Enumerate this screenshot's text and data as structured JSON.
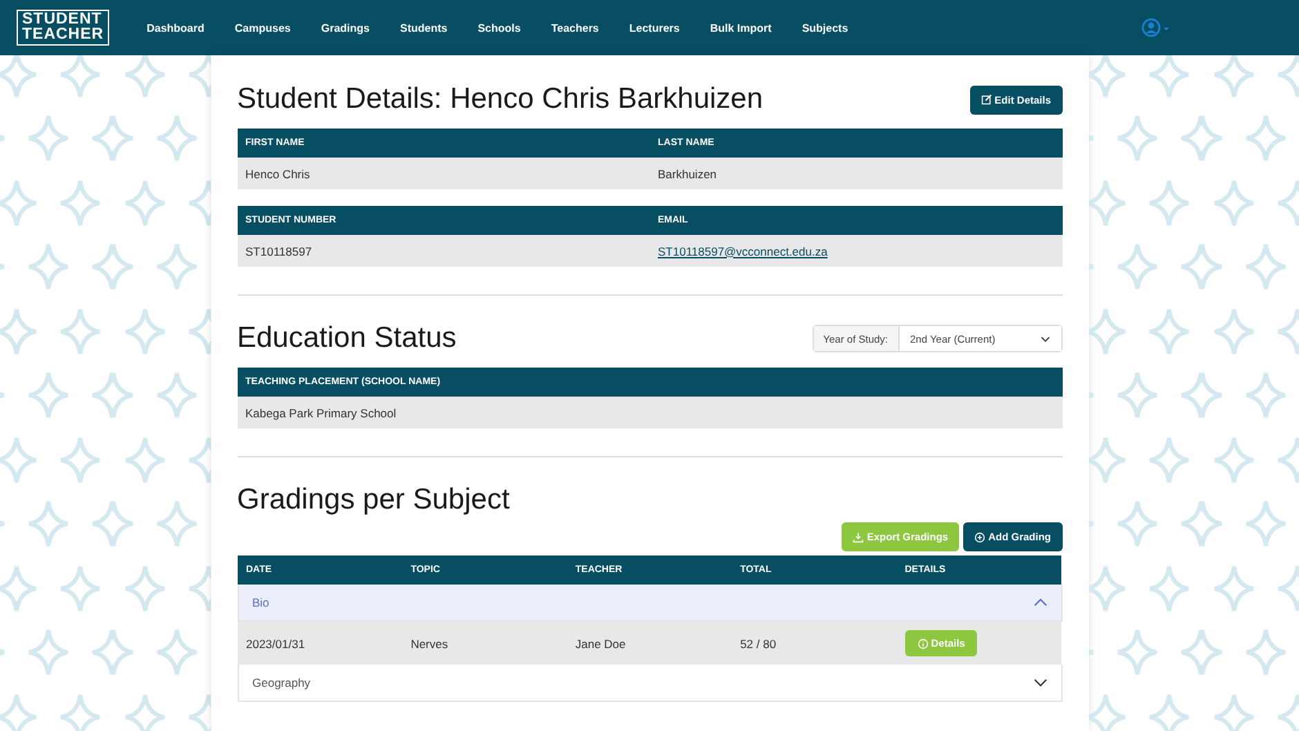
{
  "nav": {
    "logo": [
      "STUDENT",
      "TEACHER"
    ],
    "items": [
      "Dashboard",
      "Campuses",
      "Gradings",
      "Students",
      "Schools",
      "Teachers",
      "Lecturers",
      "Bulk Import",
      "Subjects"
    ]
  },
  "student": {
    "title": "Student Details: Henco Chris Barkhuizen",
    "edit_button": "Edit Details",
    "tables": [
      {
        "columns": [
          "FIRST NAME",
          "LAST NAME"
        ],
        "cells": [
          {
            "kind": "text",
            "text": "Henco Chris"
          },
          {
            "kind": "text",
            "text": "Barkhuizen"
          }
        ]
      },
      {
        "columns": [
          "STUDENT NUMBER",
          "EMAIL"
        ],
        "cells": [
          {
            "kind": "text",
            "text": "ST10118597"
          },
          {
            "kind": "link",
            "text": "ST10118597@vcconnect.edu.za"
          }
        ]
      }
    ]
  },
  "education": {
    "title": "Education Status",
    "year_label": "Year of Study:",
    "year_value": "2nd Year (Current)",
    "column": "TEACHING PLACEMENT (SCHOOL NAME)",
    "school": "Kabega Park Primary School"
  },
  "gradings": {
    "title": "Gradings per Subject",
    "export_button": "Export Gradings",
    "add_button": "Add Grading",
    "columns": [
      "DATE",
      "TOPIC",
      "TEACHER",
      "TOTAL",
      "DETAILS"
    ],
    "groups": [
      {
        "name": "Bio",
        "expanded": true,
        "rows": [
          {
            "date": "2023/01/31",
            "topic": "Nerves",
            "teacher": "Jane Doe",
            "total": "52 / 80",
            "button": "Details"
          }
        ]
      },
      {
        "name": "Geography",
        "expanded": false
      }
    ]
  }
}
